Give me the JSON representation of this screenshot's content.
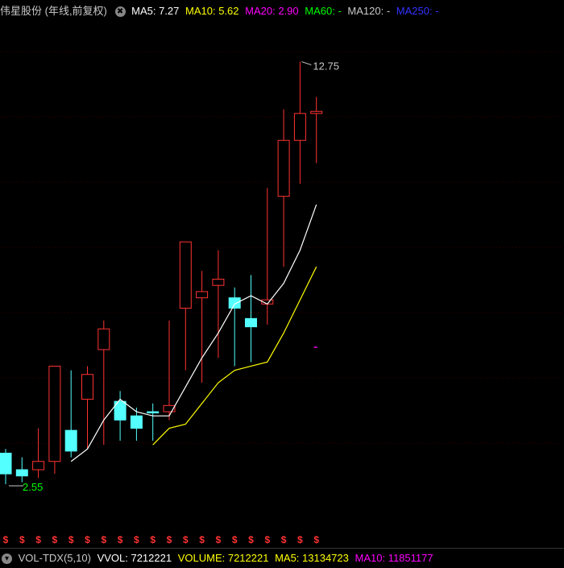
{
  "header": {
    "stock_title": "伟星股份 (年线,前复权)",
    "ma5": "MA5: 7.27",
    "ma10": "MA10: 5.62",
    "ma20": "MA20: 2.90",
    "ma60": "MA60: -",
    "ma120": "MA120: -",
    "ma250": "MA250: -"
  },
  "footer": {
    "indicator": "VOL-TDX(5,10)",
    "vvol": "VVOL: 7212221",
    "volume": "VOLUME: 7212221",
    "ma5": "MA5: 13134723",
    "ma10": "MA10: 11851177"
  },
  "colors": {
    "up": "#ff3232",
    "down": "#54ffff",
    "ma5": "#ffffff",
    "ma10": "#ffff00",
    "ma20": "#ff00ff",
    "ma60": "#00ff00",
    "ma120": "#c8c8c8",
    "ma250": "#3232ff",
    "dividend_marker": "#ff3232"
  },
  "chart_data": {
    "type": "candlestick",
    "ylim": [
      1.5,
      13.5
    ],
    "grid": "horizontal-dotted",
    "annotations": {
      "high_label": "12.75",
      "low_label": "2.55"
    },
    "dividend_marker_glyph": "$",
    "candles": [
      {
        "o": 3.3,
        "c": 2.8,
        "h": 3.4,
        "l": 2.55,
        "dir": "down"
      },
      {
        "o": 2.9,
        "c": 2.75,
        "h": 3.2,
        "l": 2.6,
        "dir": "down"
      },
      {
        "o": 2.9,
        "c": 3.1,
        "h": 3.9,
        "l": 2.7,
        "dir": "up"
      },
      {
        "o": 3.1,
        "c": 5.4,
        "h": 5.4,
        "l": 2.8,
        "dir": "up"
      },
      {
        "o": 3.85,
        "c": 3.35,
        "h": 5.3,
        "l": 3.2,
        "dir": "down"
      },
      {
        "o": 4.6,
        "c": 5.2,
        "h": 5.4,
        "l": 3.4,
        "dir": "up"
      },
      {
        "o": 5.8,
        "c": 6.3,
        "h": 6.5,
        "l": 3.5,
        "dir": "up"
      },
      {
        "o": 4.55,
        "c": 4.1,
        "h": 4.8,
        "l": 3.6,
        "dir": "down"
      },
      {
        "o": 4.2,
        "c": 3.9,
        "h": 4.4,
        "l": 3.6,
        "dir": "down"
      },
      {
        "o": 4.3,
        "c": 4.3,
        "h": 4.5,
        "l": 3.6,
        "dir": "down"
      },
      {
        "o": 4.3,
        "c": 4.45,
        "h": 6.5,
        "l": 4.1,
        "dir": "up"
      },
      {
        "o": 6.8,
        "c": 8.4,
        "h": 8.4,
        "l": 5.3,
        "dir": "up"
      },
      {
        "o": 7.05,
        "c": 7.2,
        "h": 7.7,
        "l": 5.0,
        "dir": "up"
      },
      {
        "o": 7.35,
        "c": 7.5,
        "h": 8.2,
        "l": 5.6,
        "dir": "up"
      },
      {
        "o": 7.05,
        "c": 6.8,
        "h": 7.3,
        "l": 5.4,
        "dir": "down"
      },
      {
        "o": 6.55,
        "c": 6.35,
        "h": 7.6,
        "l": 5.5,
        "dir": "down"
      },
      {
        "o": 6.9,
        "c": 7.0,
        "h": 9.7,
        "l": 6.4,
        "dir": "up"
      },
      {
        "o": 9.5,
        "c": 10.85,
        "h": 11.6,
        "l": 7.8,
        "dir": "up"
      },
      {
        "o": 10.85,
        "c": 11.5,
        "h": 12.75,
        "l": 9.8,
        "dir": "up"
      },
      {
        "o": 11.5,
        "c": 11.55,
        "h": 11.9,
        "l": 10.3,
        "dir": "up"
      }
    ],
    "ma5_series": [
      null,
      null,
      null,
      null,
      3.1,
      3.4,
      4.1,
      4.6,
      4.3,
      4.2,
      4.2,
      4.9,
      5.6,
      6.2,
      6.9,
      7.1,
      6.9,
      7.4,
      8.2,
      9.3
    ],
    "ma10_series": [
      null,
      null,
      null,
      null,
      null,
      null,
      null,
      null,
      null,
      3.5,
      3.9,
      4.0,
      4.5,
      5.0,
      5.3,
      5.4,
      5.5,
      6.2,
      7.0,
      7.8
    ]
  }
}
